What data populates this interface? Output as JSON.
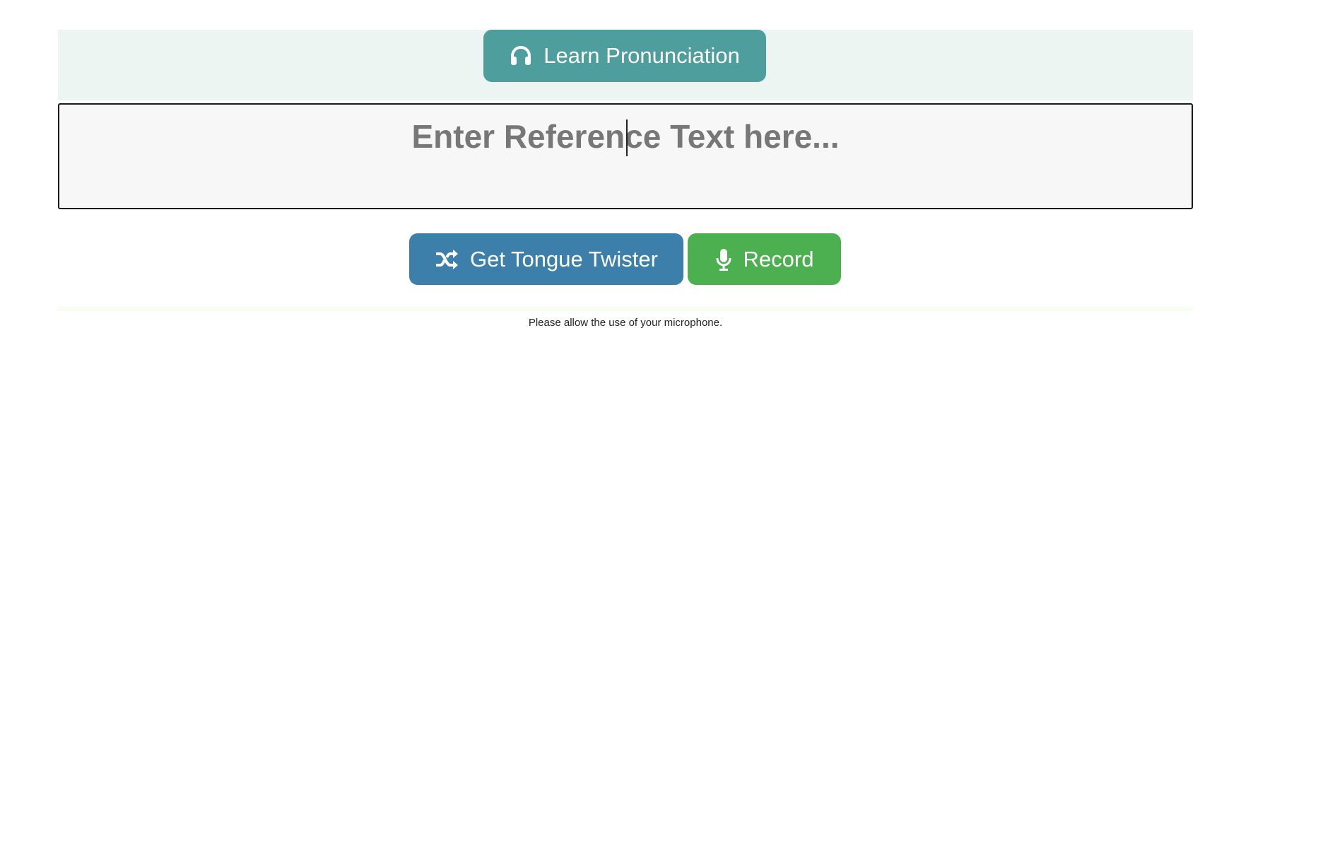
{
  "header": {
    "learn_button_label": "Learn Pronunciation",
    "learn_button_icon": "headphones-icon"
  },
  "reference": {
    "placeholder": "Enter Reference Text here..."
  },
  "actions": {
    "twister_label": "Get Tongue Twister",
    "twister_icon": "shuffle-icon",
    "record_label": "Record",
    "record_icon": "microphone-icon"
  },
  "status": {
    "message": "Please allow the use of your microphone."
  },
  "colors": {
    "learn_button": "#4f9e9e",
    "twister_button": "#3b7faa",
    "record_button": "#4caf50",
    "header_band": "#edf5f3"
  }
}
